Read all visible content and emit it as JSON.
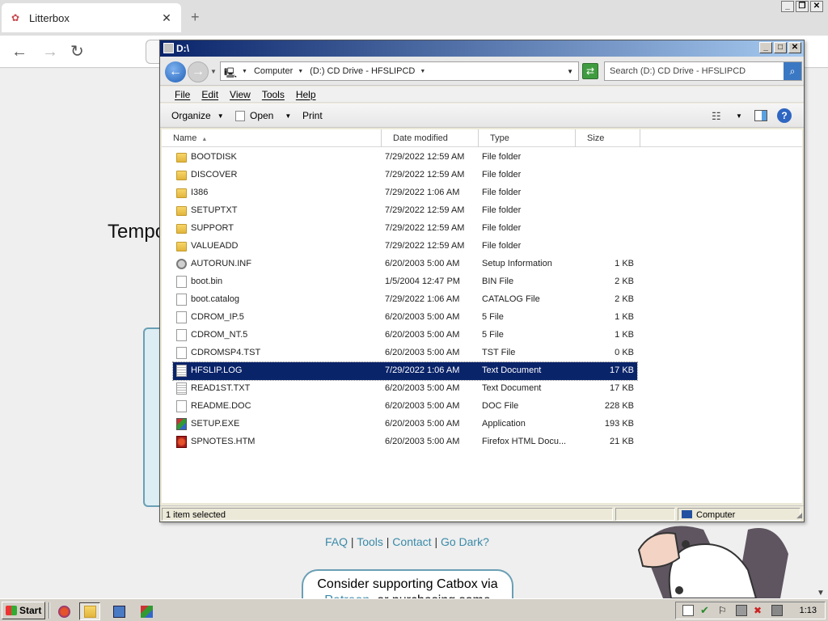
{
  "browser": {
    "tab_title": "Litterbox",
    "tab_close": "✕",
    "new_tab": "+",
    "back": "←",
    "forward": "→",
    "reload": "↻",
    "page_text": "Tempo",
    "footer": {
      "faq": "FAQ",
      "tools": "Tools",
      "contact": "Contact",
      "dark": "Go Dark?",
      "divider": "|"
    },
    "support_line1": "Consider supporting Catbox via",
    "support_patreon": "Patreon",
    "support_rest": ", or purchasing some"
  },
  "explorer": {
    "title": "D:\\",
    "address": {
      "computer": "Computer",
      "drive": "(D:) CD Drive - HFSLIPCD"
    },
    "search_placeholder": "Search (D:) CD Drive - HFSLIPCD",
    "menu": [
      "File",
      "Edit",
      "View",
      "Tools",
      "Help"
    ],
    "toolbar": {
      "organize": "Organize",
      "open": "Open",
      "print": "Print"
    },
    "columns": {
      "name": "Name",
      "date": "Date modified",
      "type": "Type",
      "size": "Size"
    },
    "files": [
      {
        "name": "BOOTDISK",
        "date": "7/29/2022 12:59 AM",
        "type": "File folder",
        "size": "",
        "icon": "folder-icon"
      },
      {
        "name": "DISCOVER",
        "date": "7/29/2022 12:59 AM",
        "type": "File folder",
        "size": "",
        "icon": "folder-icon"
      },
      {
        "name": "I386",
        "date": "7/29/2022 1:06 AM",
        "type": "File folder",
        "size": "",
        "icon": "folder-icon"
      },
      {
        "name": "SETUPTXT",
        "date": "7/29/2022 12:59 AM",
        "type": "File folder",
        "size": "",
        "icon": "folder-icon"
      },
      {
        "name": "SUPPORT",
        "date": "7/29/2022 12:59 AM",
        "type": "File folder",
        "size": "",
        "icon": "folder-icon"
      },
      {
        "name": "VALUEADD",
        "date": "7/29/2022 12:59 AM",
        "type": "File folder",
        "size": "",
        "icon": "folder-icon"
      },
      {
        "name": "AUTORUN.INF",
        "date": "6/20/2003 5:00 AM",
        "type": "Setup Information",
        "size": "1 KB",
        "icon": "settings-file-icon"
      },
      {
        "name": "boot.bin",
        "date": "1/5/2004 12:47 PM",
        "type": "BIN File",
        "size": "2 KB",
        "icon": "file-icon"
      },
      {
        "name": "boot.catalog",
        "date": "7/29/2022 1:06 AM",
        "type": "CATALOG File",
        "size": "2 KB",
        "icon": "file-icon"
      },
      {
        "name": "CDROM_IP.5",
        "date": "6/20/2003 5:00 AM",
        "type": "5 File",
        "size": "1 KB",
        "icon": "file-icon"
      },
      {
        "name": "CDROM_NT.5",
        "date": "6/20/2003 5:00 AM",
        "type": "5 File",
        "size": "1 KB",
        "icon": "file-icon"
      },
      {
        "name": "CDROMSP4.TST",
        "date": "6/20/2003 5:00 AM",
        "type": "TST File",
        "size": "0 KB",
        "icon": "file-icon"
      },
      {
        "name": "HFSLIP.LOG",
        "date": "7/29/2022 1:06 AM",
        "type": "Text Document",
        "size": "17 KB",
        "icon": "text-file-icon",
        "selected": true
      },
      {
        "name": "READ1ST.TXT",
        "date": "6/20/2003 5:00 AM",
        "type": "Text Document",
        "size": "17 KB",
        "icon": "text-file-icon"
      },
      {
        "name": "README.DOC",
        "date": "6/20/2003 5:00 AM",
        "type": "DOC File",
        "size": "228 KB",
        "icon": "file-icon"
      },
      {
        "name": "SETUP.EXE",
        "date": "6/20/2003 5:00 AM",
        "type": "Application",
        "size": "193 KB",
        "icon": "application-icon"
      },
      {
        "name": "SPNOTES.HTM",
        "date": "6/20/2003 5:00 AM",
        "type": "Firefox HTML Docu...",
        "size": "21 KB",
        "icon": "html-file-icon"
      }
    ],
    "status": {
      "selection": "1 item selected",
      "zone": "Computer"
    }
  },
  "taskbar": {
    "start": "Start",
    "clock": "1:13"
  },
  "colors": {
    "selection": "#0a246a",
    "title_start": "#0a246a",
    "title_end": "#a6caf0",
    "link": "#3a8aa8"
  }
}
